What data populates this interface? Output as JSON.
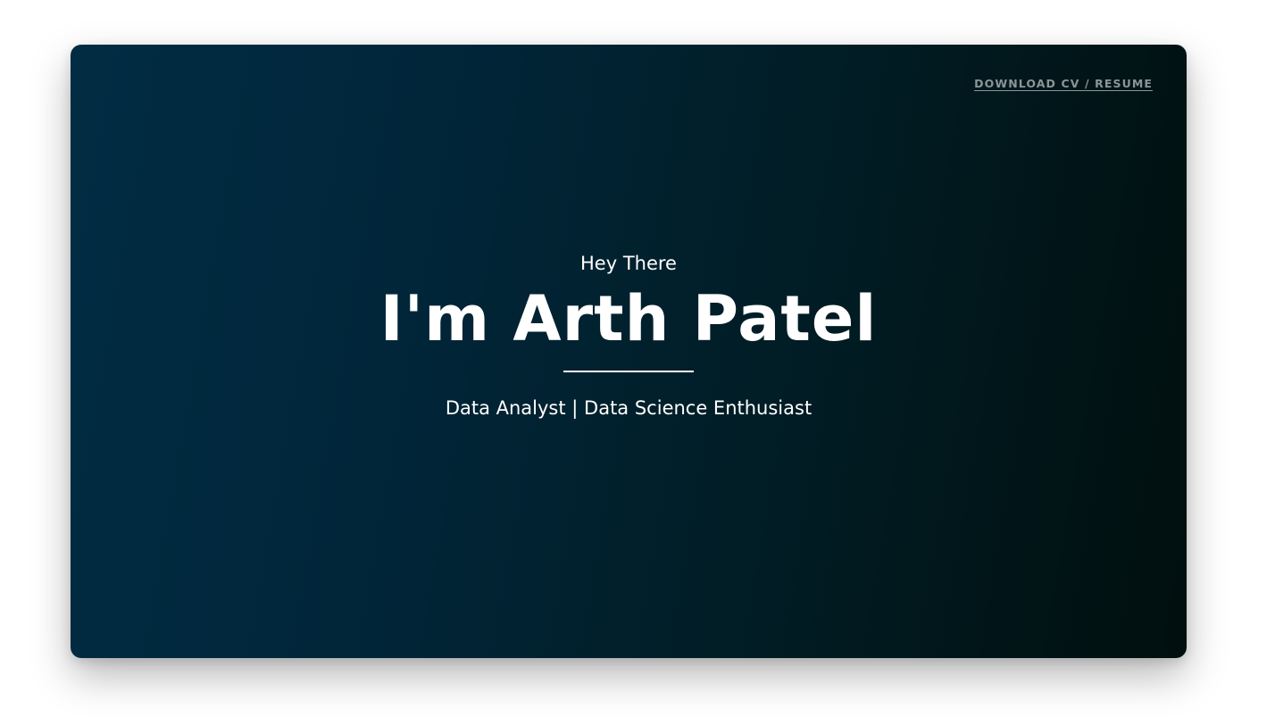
{
  "header": {
    "download_link_label": "DOWNLOAD CV / RESUME"
  },
  "hero": {
    "greeting": "Hey There",
    "title": "I'm Arth Patel",
    "tagline": "Data Analyst | Data Science Enthusiast"
  },
  "colors": {
    "gradient_start": "#012c43",
    "gradient_end": "#010f0e",
    "text_primary": "#ffffff",
    "link_muted": "#8c9598"
  }
}
